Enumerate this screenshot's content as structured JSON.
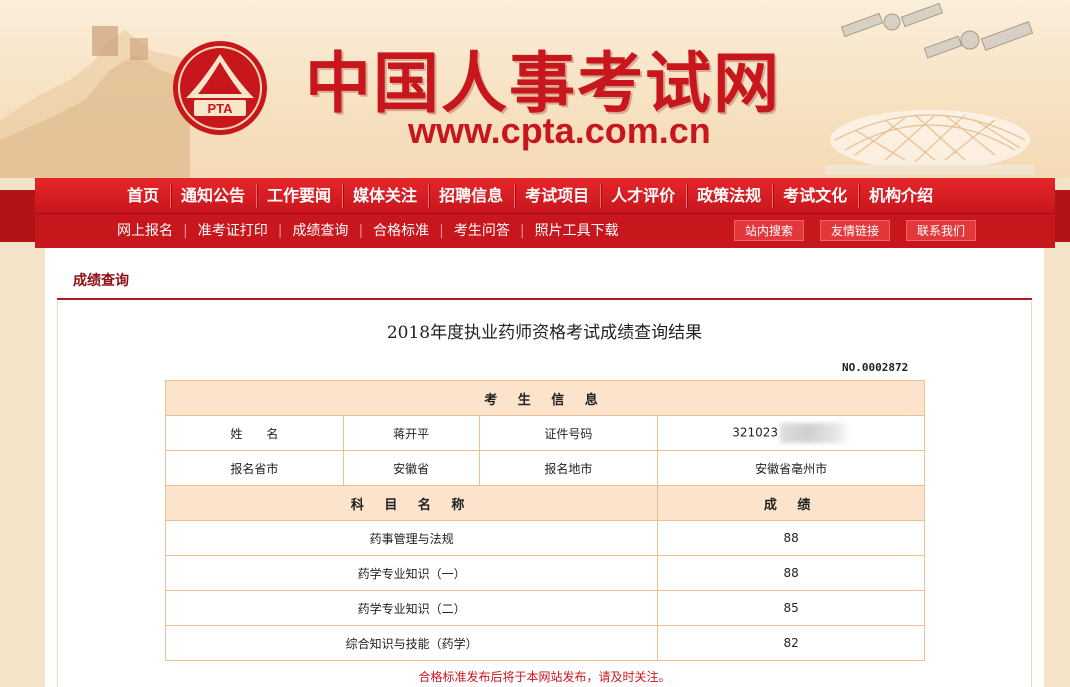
{
  "header": {
    "title": "中国人事考试网",
    "url": "www.cpta.com.cn",
    "logo_text": "PTA"
  },
  "nav": {
    "main": [
      "首页",
      "通知公告",
      "工作要闻",
      "媒体关注",
      "招聘信息",
      "考试项目",
      "人才评价",
      "政策法规",
      "考试文化",
      "机构介绍"
    ],
    "sub": [
      "网上报名",
      "准考证打印",
      "成绩查询",
      "合格标准",
      "考生问答",
      "照片工具下载"
    ],
    "pills": [
      "站内搜索",
      "友情链接",
      "联系我们"
    ]
  },
  "breadcrumb": "成绩查询",
  "result": {
    "title": "2018年度执业药师资格考试成绩查询结果",
    "doc_no": "NO.0002872",
    "section_candidate": "考 生 信 息",
    "name_label": "姓　　名",
    "name_value": "蒋开平",
    "id_label": "证件号码",
    "id_value": "321023",
    "province_label": "报名省市",
    "province_value": "安徽省",
    "city_label": "报名地市",
    "city_value": "安徽省亳州市",
    "subject_header": "科 目 名 称",
    "score_header": "成 绩",
    "subjects": [
      {
        "name": "药事管理与法规",
        "score": "88"
      },
      {
        "name": "药学专业知识（一）",
        "score": "88"
      },
      {
        "name": "药学专业知识（二）",
        "score": "85"
      },
      {
        "name": "综合知识与技能（药学）",
        "score": "82"
      }
    ],
    "note": "合格标准发布后将于本网站发布，请及时关注。"
  },
  "colors": {
    "brand_red": "#c8161d",
    "table_border": "#eebf92",
    "table_head_bg": "#fbe4cb"
  }
}
